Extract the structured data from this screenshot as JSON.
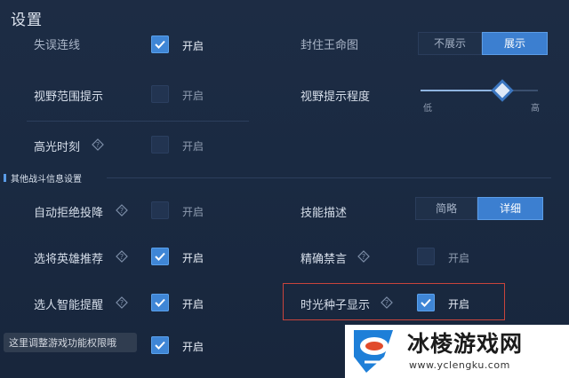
{
  "window": {
    "title": "设置"
  },
  "rows_left": [
    {
      "label": "失误连线",
      "checked": true,
      "value": "开启",
      "has_help": false
    },
    {
      "label": "视野范围提示",
      "checked": false,
      "value": "开启",
      "has_help": false
    },
    {
      "label": "高光时刻",
      "checked": false,
      "value": "开启",
      "has_help": true
    }
  ],
  "section": {
    "title": "其他战斗信息设置"
  },
  "rows_left_2": [
    {
      "label": "自动拒绝投降",
      "checked": false,
      "value": "开启",
      "has_help": true
    },
    {
      "label": "选将英雄推荐",
      "checked": true,
      "value": "开启",
      "has_help": true
    },
    {
      "label": "选人智能提醒",
      "checked": true,
      "value": "开启",
      "has_help": true
    },
    {
      "label": "",
      "checked": true,
      "value": "开启",
      "has_help": false
    }
  ],
  "right": {
    "top_label": "封住王命图",
    "top_options": [
      "不展示",
      "展示"
    ],
    "top_selected": 1,
    "slider": {
      "label": "视野提示程度",
      "low": "低",
      "high": "高",
      "value": 0.7
    },
    "skill_desc": {
      "label": "技能描述",
      "options": [
        "简略",
        "详细"
      ],
      "selected": 1
    },
    "precise_ban": {
      "label": "精确禁言",
      "checked": false,
      "value": "开启",
      "has_help": true
    },
    "time_seed": {
      "label": "时光种子显示",
      "checked": true,
      "value": "开启",
      "has_help": true
    }
  },
  "tooltip": {
    "text": "这里调整游戏功能权限哦"
  },
  "watermark": {
    "title": "冰棱游戏网",
    "url": "www.yclengku.com"
  },
  "colors": {
    "accent": "#3f86d6",
    "highlight_border": "#c8443c",
    "background": "#1b2a42"
  }
}
